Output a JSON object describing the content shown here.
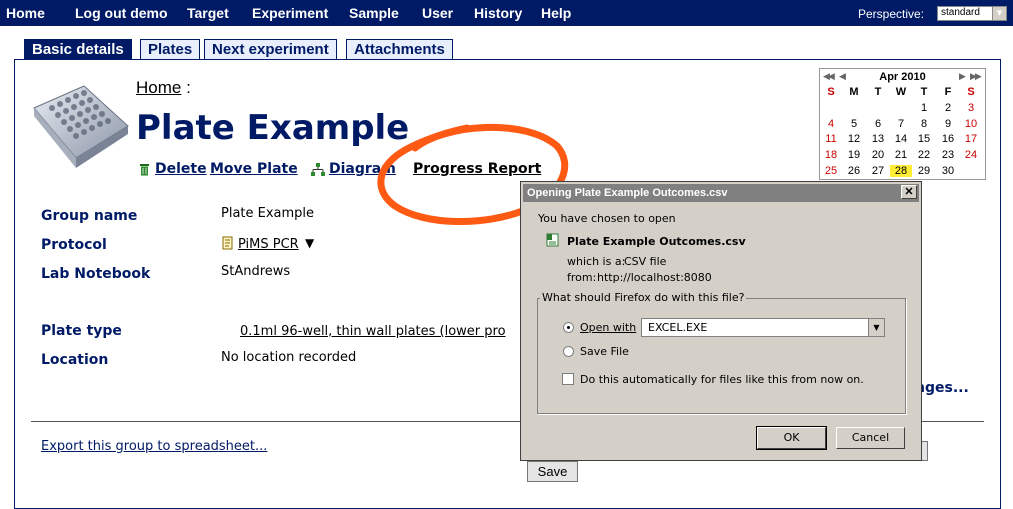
{
  "nav": {
    "items": [
      "Home",
      "Log out demo",
      "Target",
      "Experiment",
      "Sample",
      "User",
      "History",
      "Help"
    ],
    "perspective_label": "Perspective:",
    "perspective_value": "standard"
  },
  "tabs": [
    "Basic details",
    "Plates",
    "Next experiment",
    "Attachments"
  ],
  "breadcrumb": {
    "home": "Home",
    "sep": ":"
  },
  "page_title": "Plate Example",
  "actions": {
    "delete": "Delete",
    "move_plate": "Move Plate",
    "diagram": "Diagram",
    "progress_report": "Progress Report"
  },
  "fields": {
    "group_name": {
      "label": "Group name",
      "value": "Plate Example"
    },
    "protocol": {
      "label": "Protocol",
      "value": "PiMS PCR"
    },
    "lab_notebook": {
      "label": "Lab Notebook",
      "value": "StAndrews"
    },
    "plate_type": {
      "label": "Plate type",
      "value": "0.1ml 96-well, thin wall plates (lower pro"
    },
    "location": {
      "label": "Location",
      "value": "No location recorded"
    }
  },
  "changes_link": "nges...",
  "export_link": "Export this group to spreadsheet...",
  "save_button": "Save",
  "calendar": {
    "title": "Apr 2010",
    "weekdays": [
      "S",
      "M",
      "T",
      "W",
      "T",
      "F",
      "S"
    ],
    "weeks": [
      [
        "",
        "",
        "",
        "",
        "1",
        "2",
        "3"
      ],
      [
        "4",
        "5",
        "6",
        "7",
        "8",
        "9",
        "10"
      ],
      [
        "11",
        "12",
        "13",
        "14",
        "15",
        "16",
        "17"
      ],
      [
        "18",
        "19",
        "20",
        "21",
        "22",
        "23",
        "24"
      ],
      [
        "25",
        "26",
        "27",
        "28",
        "29",
        "30",
        ""
      ]
    ],
    "today": "28",
    "weekend_color": "#cc0000",
    "today_color": "#ffee33"
  },
  "dialog": {
    "title": "Opening Plate Example Outcomes.csv",
    "intro": "You have chosen to open",
    "filename": "Plate Example Outcomes.csv",
    "which_is_label": "which is a:",
    "which_is_value": "CSV file",
    "from_label": "from:",
    "from_value": "http://localhost:8080",
    "group_title": "What should Firefox do with this file?",
    "open_with_label": "Open with",
    "open_with_app": "EXCEL.EXE",
    "save_file_label": "Save File",
    "auto_label": "Do this automatically for files like this from now on.",
    "ok": "OK",
    "cancel": "Cancel"
  },
  "colors": {
    "nav_bg": "#001a66",
    "accent": "#001a66",
    "annotation": "#ff5a14",
    "dialog_bg": "#d4d0c8"
  }
}
